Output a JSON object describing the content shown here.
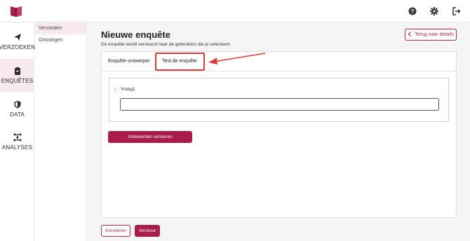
{
  "colors": {
    "brand": "#a91d4d",
    "annotation": "#e53935",
    "active_bg": "#f7e9ee"
  },
  "topbar": {
    "icons": [
      "app-logo-icon",
      "help-icon",
      "gear-icon",
      "logout-icon"
    ]
  },
  "leftnav": {
    "items": [
      {
        "label": "VERZOEKEN",
        "icon": "send-icon"
      },
      {
        "label": "ENQUÊTES",
        "icon": "clipboard-icon",
        "active": true
      },
      {
        "label": "DATA",
        "icon": "shield-icon"
      },
      {
        "label": "ANALYSES",
        "icon": "network-icon"
      }
    ]
  },
  "subnav": {
    "items": [
      {
        "label": "Verzonden",
        "active": true
      },
      {
        "label": "Ontvangen"
      }
    ]
  },
  "main": {
    "title": "Nieuwe enquête",
    "subtitle": "De enquête wordt verstuurd naar de gebruikers die je selecteert.",
    "back_label": "Terug naar details",
    "tabs": [
      {
        "label": "Enquête-ontwerper"
      },
      {
        "label": "Test de enquête",
        "active": true
      }
    ],
    "question": {
      "number": "1.",
      "label": "Vraag1",
      "value": ""
    },
    "submit_answers_label": "Antwoorden versturen",
    "cancel_label": "Annuleren",
    "send_label": "Verstuur"
  }
}
